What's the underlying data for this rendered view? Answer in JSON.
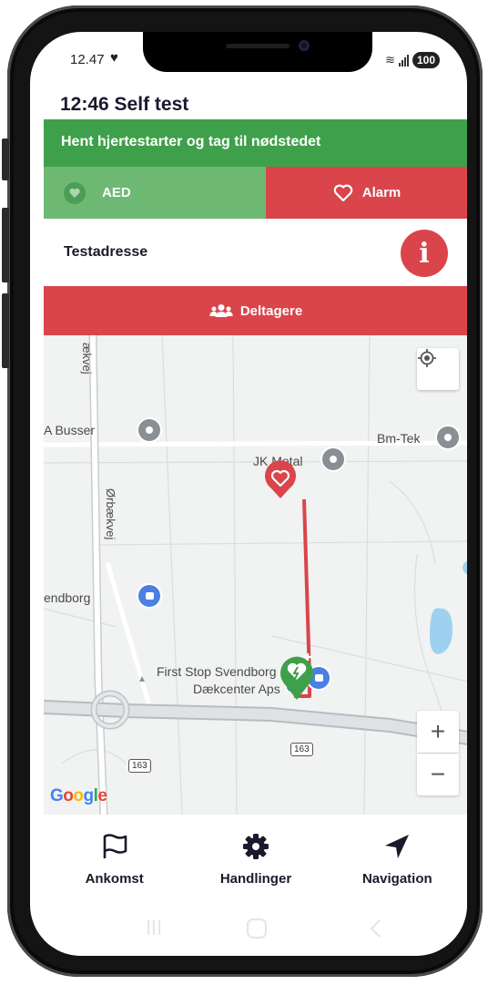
{
  "status_bar": {
    "time": "12.47",
    "battery": "100"
  },
  "header": {
    "title": "12:46 Self test"
  },
  "banner": {
    "text": "Hent hjertestarter og tag til nødstedet",
    "color": "#3fa04b"
  },
  "tabs": [
    {
      "label": "AED",
      "color": "#6db974"
    },
    {
      "label": "Alarm",
      "color": "#d9454b"
    }
  ],
  "address": {
    "text": "Testadresse"
  },
  "participants": {
    "label": "Deltagere"
  },
  "map": {
    "labels": {
      "busser": "A Busser",
      "bmtek": "Bm-Tek",
      "jkmetal": "JK Metal",
      "orbaekvej": "Ørbækvej",
      "ekvej": "ækvej",
      "svendborg": "endborg",
      "firststop_line1": "First Stop Svendborg",
      "firststop_line2": "Dækcenter Aps",
      "road_163_a": "163",
      "road_163_b": "163"
    },
    "route_color": "#d9454b",
    "google": [
      "G",
      "o",
      "o",
      "g",
      "l",
      "e"
    ]
  },
  "bottom_nav": [
    {
      "label": "Ankomst",
      "icon": "flag-icon"
    },
    {
      "label": "Handlinger",
      "icon": "gear-icon"
    },
    {
      "label": "Navigation",
      "icon": "navigation-arrow-icon"
    }
  ]
}
